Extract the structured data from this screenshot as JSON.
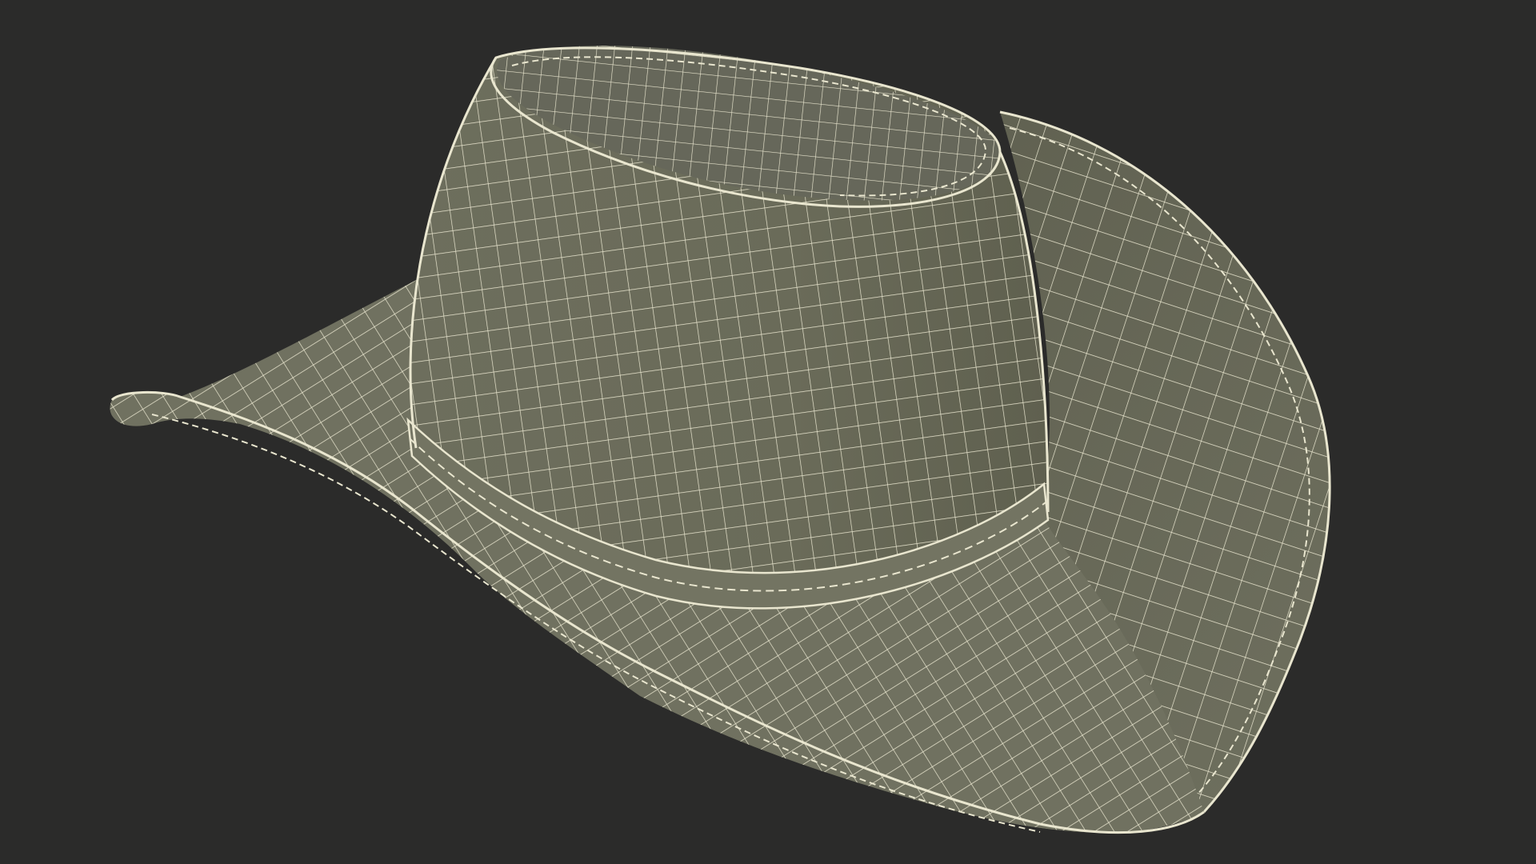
{
  "scene": {
    "background_color": "#2b2b2a",
    "subject": "cowboy-hat-wireframe",
    "mesh_fill_color": "#6e6f5e",
    "mesh_fill_dark_color": "#5a5b4c",
    "wire_color": "#e9e6cf"
  }
}
